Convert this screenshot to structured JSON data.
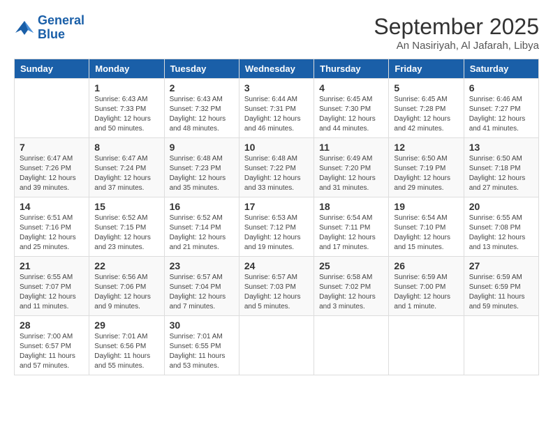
{
  "header": {
    "logo_line1": "General",
    "logo_line2": "Blue",
    "month": "September 2025",
    "location": "An Nasiriyah, Al Jafarah, Libya"
  },
  "days_of_week": [
    "Sunday",
    "Monday",
    "Tuesday",
    "Wednesday",
    "Thursday",
    "Friday",
    "Saturday"
  ],
  "weeks": [
    [
      {
        "day": "",
        "info": ""
      },
      {
        "day": "1",
        "info": "Sunrise: 6:43 AM\nSunset: 7:33 PM\nDaylight: 12 hours\nand 50 minutes."
      },
      {
        "day": "2",
        "info": "Sunrise: 6:43 AM\nSunset: 7:32 PM\nDaylight: 12 hours\nand 48 minutes."
      },
      {
        "day": "3",
        "info": "Sunrise: 6:44 AM\nSunset: 7:31 PM\nDaylight: 12 hours\nand 46 minutes."
      },
      {
        "day": "4",
        "info": "Sunrise: 6:45 AM\nSunset: 7:30 PM\nDaylight: 12 hours\nand 44 minutes."
      },
      {
        "day": "5",
        "info": "Sunrise: 6:45 AM\nSunset: 7:28 PM\nDaylight: 12 hours\nand 42 minutes."
      },
      {
        "day": "6",
        "info": "Sunrise: 6:46 AM\nSunset: 7:27 PM\nDaylight: 12 hours\nand 41 minutes."
      }
    ],
    [
      {
        "day": "7",
        "info": "Sunrise: 6:47 AM\nSunset: 7:26 PM\nDaylight: 12 hours\nand 39 minutes."
      },
      {
        "day": "8",
        "info": "Sunrise: 6:47 AM\nSunset: 7:24 PM\nDaylight: 12 hours\nand 37 minutes."
      },
      {
        "day": "9",
        "info": "Sunrise: 6:48 AM\nSunset: 7:23 PM\nDaylight: 12 hours\nand 35 minutes."
      },
      {
        "day": "10",
        "info": "Sunrise: 6:48 AM\nSunset: 7:22 PM\nDaylight: 12 hours\nand 33 minutes."
      },
      {
        "day": "11",
        "info": "Sunrise: 6:49 AM\nSunset: 7:20 PM\nDaylight: 12 hours\nand 31 minutes."
      },
      {
        "day": "12",
        "info": "Sunrise: 6:50 AM\nSunset: 7:19 PM\nDaylight: 12 hours\nand 29 minutes."
      },
      {
        "day": "13",
        "info": "Sunrise: 6:50 AM\nSunset: 7:18 PM\nDaylight: 12 hours\nand 27 minutes."
      }
    ],
    [
      {
        "day": "14",
        "info": "Sunrise: 6:51 AM\nSunset: 7:16 PM\nDaylight: 12 hours\nand 25 minutes."
      },
      {
        "day": "15",
        "info": "Sunrise: 6:52 AM\nSunset: 7:15 PM\nDaylight: 12 hours\nand 23 minutes."
      },
      {
        "day": "16",
        "info": "Sunrise: 6:52 AM\nSunset: 7:14 PM\nDaylight: 12 hours\nand 21 minutes."
      },
      {
        "day": "17",
        "info": "Sunrise: 6:53 AM\nSunset: 7:12 PM\nDaylight: 12 hours\nand 19 minutes."
      },
      {
        "day": "18",
        "info": "Sunrise: 6:54 AM\nSunset: 7:11 PM\nDaylight: 12 hours\nand 17 minutes."
      },
      {
        "day": "19",
        "info": "Sunrise: 6:54 AM\nSunset: 7:10 PM\nDaylight: 12 hours\nand 15 minutes."
      },
      {
        "day": "20",
        "info": "Sunrise: 6:55 AM\nSunset: 7:08 PM\nDaylight: 12 hours\nand 13 minutes."
      }
    ],
    [
      {
        "day": "21",
        "info": "Sunrise: 6:55 AM\nSunset: 7:07 PM\nDaylight: 12 hours\nand 11 minutes."
      },
      {
        "day": "22",
        "info": "Sunrise: 6:56 AM\nSunset: 7:06 PM\nDaylight: 12 hours\nand 9 minutes."
      },
      {
        "day": "23",
        "info": "Sunrise: 6:57 AM\nSunset: 7:04 PM\nDaylight: 12 hours\nand 7 minutes."
      },
      {
        "day": "24",
        "info": "Sunrise: 6:57 AM\nSunset: 7:03 PM\nDaylight: 12 hours\nand 5 minutes."
      },
      {
        "day": "25",
        "info": "Sunrise: 6:58 AM\nSunset: 7:02 PM\nDaylight: 12 hours\nand 3 minutes."
      },
      {
        "day": "26",
        "info": "Sunrise: 6:59 AM\nSunset: 7:00 PM\nDaylight: 12 hours\nand 1 minute."
      },
      {
        "day": "27",
        "info": "Sunrise: 6:59 AM\nSunset: 6:59 PM\nDaylight: 11 hours\nand 59 minutes."
      }
    ],
    [
      {
        "day": "28",
        "info": "Sunrise: 7:00 AM\nSunset: 6:57 PM\nDaylight: 11 hours\nand 57 minutes."
      },
      {
        "day": "29",
        "info": "Sunrise: 7:01 AM\nSunset: 6:56 PM\nDaylight: 11 hours\nand 55 minutes."
      },
      {
        "day": "30",
        "info": "Sunrise: 7:01 AM\nSunset: 6:55 PM\nDaylight: 11 hours\nand 53 minutes."
      },
      {
        "day": "",
        "info": ""
      },
      {
        "day": "",
        "info": ""
      },
      {
        "day": "",
        "info": ""
      },
      {
        "day": "",
        "info": ""
      }
    ]
  ]
}
